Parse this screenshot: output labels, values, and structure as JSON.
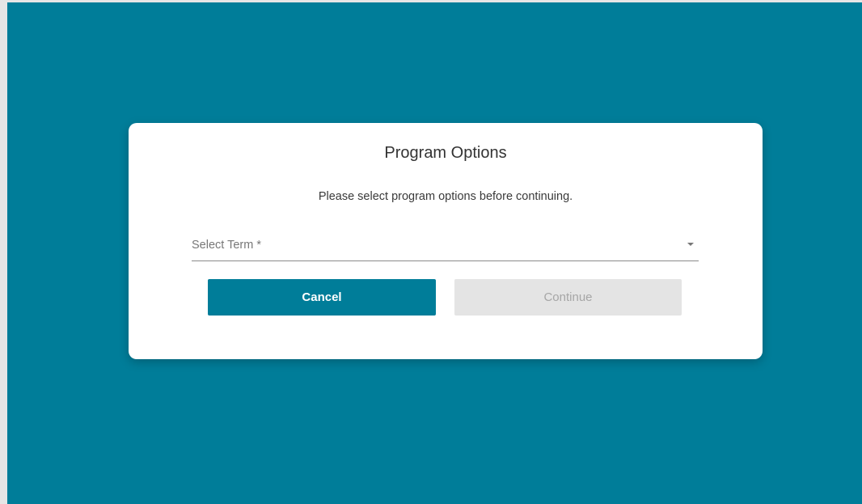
{
  "dialog": {
    "title": "Program Options",
    "message": "Please select program options before continuing.",
    "term_select": {
      "label": "Select Term *",
      "icon": "chevron-down-icon"
    },
    "cancel_label": "Cancel",
    "continue_label": "Continue",
    "continue_disabled": true
  },
  "colors": {
    "backdrop": "#007d99",
    "primary_button": "#007d99",
    "disabled_button": "#e4e4e4",
    "disabled_text": "#a6a6a6"
  }
}
